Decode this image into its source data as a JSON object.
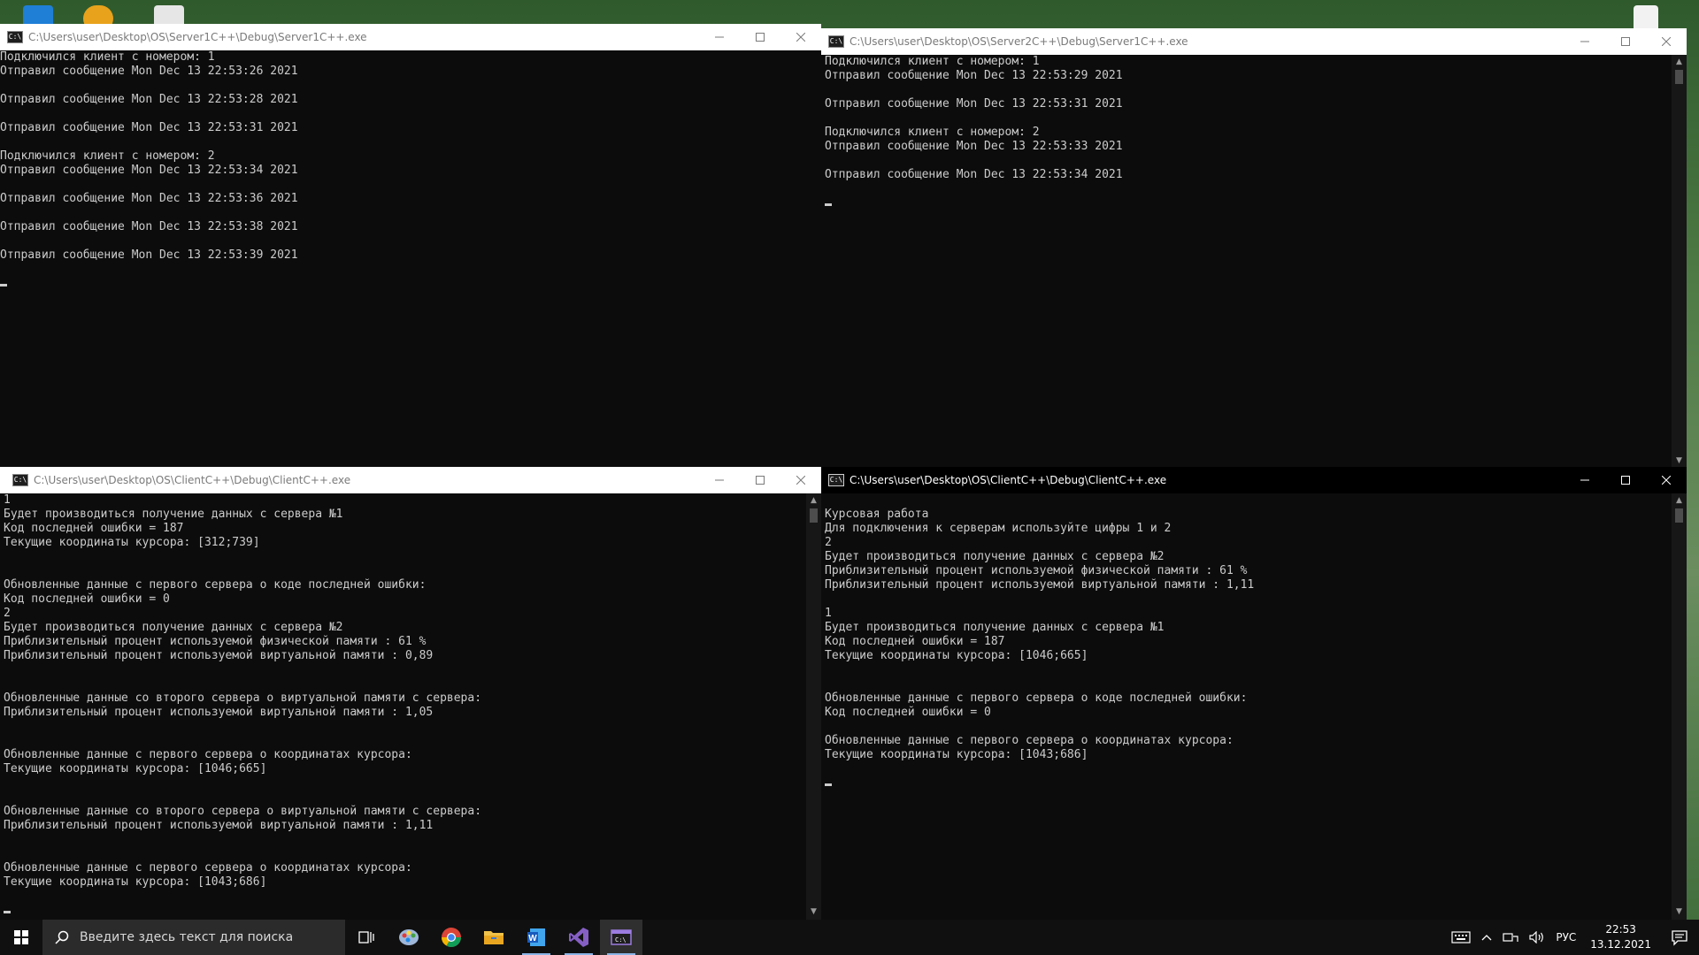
{
  "windows": {
    "server1": {
      "title": "C:\\Users\\user\\Desktop\\OS\\Server1C++\\Debug\\Server1C++.exe",
      "lines": [
        "Подключился клиент с номером: 1",
        "Отправил сообщение Mon Dec 13 22:53:26 2021",
        "",
        "Отправил сообщение Mon Dec 13 22:53:28 2021",
        "",
        "Отправил сообщение Mon Dec 13 22:53:31 2021",
        "",
        "Подключился клиент с номером: 2",
        "Отправил сообщение Mon Dec 13 22:53:34 2021",
        "",
        "Отправил сообщение Mon Dec 13 22:53:36 2021",
        "",
        "Отправил сообщение Mon Dec 13 22:53:38 2021",
        "",
        "Отправил сообщение Mon Dec 13 22:53:39 2021"
      ]
    },
    "server2": {
      "title": "C:\\Users\\user\\Desktop\\OS\\Server2C++\\Debug\\Server1C++.exe",
      "lines": [
        "Подключился клиент с номером: 1",
        "Отправил сообщение Mon Dec 13 22:53:29 2021",
        "",
        "Отправил сообщение Mon Dec 13 22:53:31 2021",
        "",
        "Подключился клиент с номером: 2",
        "Отправил сообщение Mon Dec 13 22:53:33 2021",
        "",
        "Отправил сообщение Mon Dec 13 22:53:34 2021"
      ]
    },
    "client1": {
      "title": "C:\\Users\\user\\Desktop\\OS\\ClientC++\\Debug\\ClientC++.exe",
      "lines": [
        "1",
        "Будет производиться получение данных с сервера №1",
        "Код последней ошибки = 187",
        "Текущие координаты курсора: [312;739]",
        "",
        "",
        "Обновленные данные с первого сервера о коде последней ошибки:",
        "Код последней ошибки = 0",
        "2",
        "Будет производиться получение данных с сервера №2",
        "Приблизительный процент используемой физической памяти : 61 %",
        "Приблизительный процент используемой виртуальной памяти : 0,89",
        "",
        "",
        "Обновленные данные со второго сервера о виртуальной памяти с сервера:",
        "Приблизительный процент используемой виртуальной памяти : 1,05",
        "",
        "",
        "Обновленные данные с первого сервера о координатах курсора:",
        "Текущие координаты курсора: [1046;665]",
        "",
        "",
        "Обновленные данные со второго сервера о виртуальной памяти с сервера:",
        "Приблизительный процент используемой виртуальной памяти : 1,11",
        "",
        "",
        "Обновленные данные с первого сервера о координатах курсора:",
        "Текущие координаты курсора: [1043;686]"
      ]
    },
    "client2": {
      "title": "C:\\Users\\user\\Desktop\\OS\\ClientC++\\Debug\\ClientC++.exe",
      "lines": [
        "Курсовая работа",
        "Для подключения к серверам используйте цифры 1 и 2",
        "2",
        "Будет производиться получение данных с сервера №2",
        "Приблизительный процент используемой физической памяти : 61 %",
        "Приблизительный процент используемой виртуальной памяти : 1,11",
        "",
        "1",
        "Будет производиться получение данных с сервера №1",
        "Код последней ошибки = 187",
        "Текущие координаты курсора: [1046;665]",
        "",
        "",
        "Обновленные данные с первого сервера о коде последней ошибки:",
        "Код последней ошибки = 0",
        "",
        "Обновленные данные с первого сервера о координатах курсора:",
        "Текущие координаты курсора: [1043;686]"
      ]
    }
  },
  "taskbar": {
    "search_placeholder": "Введите здесь текст для поиска",
    "apps": [
      "task-view-icon",
      "paint-icon",
      "chrome-icon",
      "file-explorer-icon",
      "word-icon",
      "visual-studio-icon",
      "console-icon"
    ],
    "tray": {
      "language": "РУС",
      "time": "22:53",
      "date": "13.12.2021"
    }
  },
  "colors": {
    "console_bg": "#0c0c0c",
    "console_text": "#cccccc",
    "taskbar_bg": "#101010",
    "accent": "#8ab4e6"
  }
}
